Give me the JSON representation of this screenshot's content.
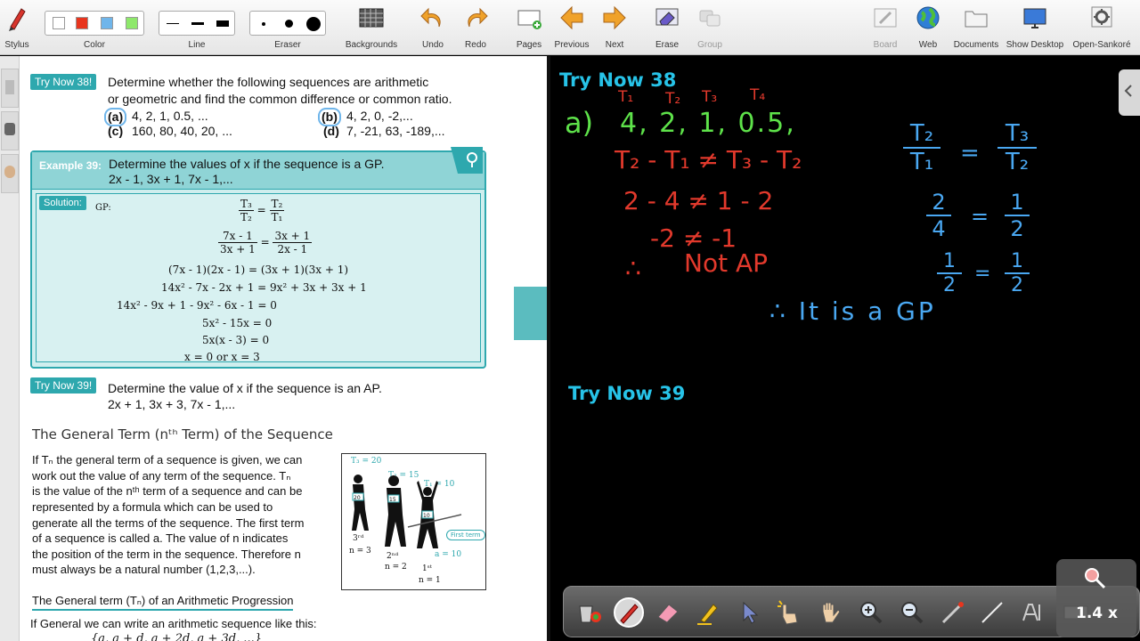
{
  "toolbar": {
    "stylus": "Stylus",
    "color": "Color",
    "line": "Line",
    "eraser": "Eraser",
    "backgrounds": "Backgrounds",
    "undo": "Undo",
    "redo": "Redo",
    "pages": "Pages",
    "previous": "Previous",
    "next": "Next",
    "erase": "Erase",
    "group": "Group",
    "board": "Board",
    "web": "Web",
    "documents": "Documents",
    "show_desktop": "Show Desktop",
    "open_sankore": "Open-Sankoré",
    "colors": [
      "#ffffff",
      "#e8351e",
      "#6fb5ea",
      "#8ee86b"
    ]
  },
  "book": {
    "try38_tag": "Try Now 38!",
    "try38_q1": "Determine whether the following sequences are arithmetic",
    "try38_q2": "or geometric and find the common difference or common ratio.",
    "a_label": "(a)",
    "a_text": "4,  2,  1, 0.5, ...",
    "b_label": "(b)",
    "b_text": "4, 2, 0, -2,...",
    "c_label": "(c)",
    "c_text": "160,  80,  40, 20, ...",
    "d_label": "(d)",
    "d_text": "7, -21, 63, -189,...",
    "ex39_tag": "Example 39:",
    "ex39_q1": "Determine the values of x if the sequence is a GP.",
    "ex39_q2": "2x - 1,  3x + 1,  7x - 1,...",
    "solution_tag": "Solution:",
    "gp_label": "GP:",
    "sol_lines": [
      "(7x - 1)(2x - 1) = (3x + 1)(3x + 1)",
      "14x² - 7x - 2x + 1 = 9x² + 3x + 3x + 1",
      "14x² - 9x + 1 - 9x² - 6x - 1 = 0",
      "5x² - 15x = 0",
      "5x(x - 3) = 0",
      "x = 0   or   x = 3"
    ],
    "frac1": {
      "a": "T₃",
      "b": "T₂",
      "c": "T₂",
      "d": "T₁"
    },
    "frac2": {
      "a": "7x - 1",
      "b": "3x + 1",
      "c": "3x + 1",
      "d": "2x - 1"
    },
    "try39_tag": "Try Now 39!",
    "try39_q1": "Determine the value of x if the sequence is an AP.",
    "try39_q2": "2x + 1,  3x + 3,  7x - 1,...",
    "gt_heading": "The General Term (nᵗʰ Term) of the Sequence",
    "gt_para": [
      "If Tₙ the general term of a sequence is given, we can",
      "work out the value of any term of the sequence.  Tₙ",
      "is the value of the nᵗʰ term of a sequence and can be",
      "represented by a formula which can be used to",
      "generate all the terms of the sequence.  The first term",
      "of a sequence is called a.  The value of n indicates",
      "the position of the term in the sequence.  Therefore n",
      "must always be a natural number (1,2,3,...)."
    ],
    "fig": {
      "t3": "T₃ = 20",
      "t2": "T₂ = 15",
      "t1": "T₁ = 10",
      "third": "3ʳᵈ",
      "n3": "n = 3",
      "second": "2ⁿᵈ",
      "n2": "n = 2",
      "first": "1ˢᵗ",
      "n1": "n = 1",
      "first_term": "First term",
      "a10": "a = 10",
      "bib3": "20",
      "bib2": "15",
      "bib1": "10"
    },
    "ap_subhead": "The General term (Tₙ) of an Arithmetic Progression",
    "ap_line": "If General we can write an arithmetic sequence like this:",
    "ap_seq": "{a, a + d, a + 2d, a + 3d, ...}"
  },
  "board": {
    "title38": "Try Now 38",
    "title39": "Try Now 39",
    "t_labels": [
      "T₁",
      "T₂",
      "T₃",
      "T₄"
    ],
    "row_a": "a)",
    "row_a_seq": "4,  2,  1,  0.5,",
    "line1": "T₂ - T₁  ≠  T₃ - T₂",
    "line2": "2 - 4  ≠  1 - 2",
    "line3": "-2  ≠  -1",
    "therefore": "∴",
    "not_ap": "Not AP",
    "f1": {
      "n": "T₂",
      "d": "T₁",
      "eq": "=",
      "n2": "T₃",
      "d2": "T₂"
    },
    "f2": {
      "n": "2",
      "d": "4",
      "eq": "=",
      "n2": "1",
      "d2": "2"
    },
    "f3": {
      "n": "1",
      "d": "2",
      "eq": "=",
      "n2": "1",
      "d2": "2"
    },
    "conclusion": "∴  It  is  a  GP",
    "zoom": "1.4 x"
  }
}
